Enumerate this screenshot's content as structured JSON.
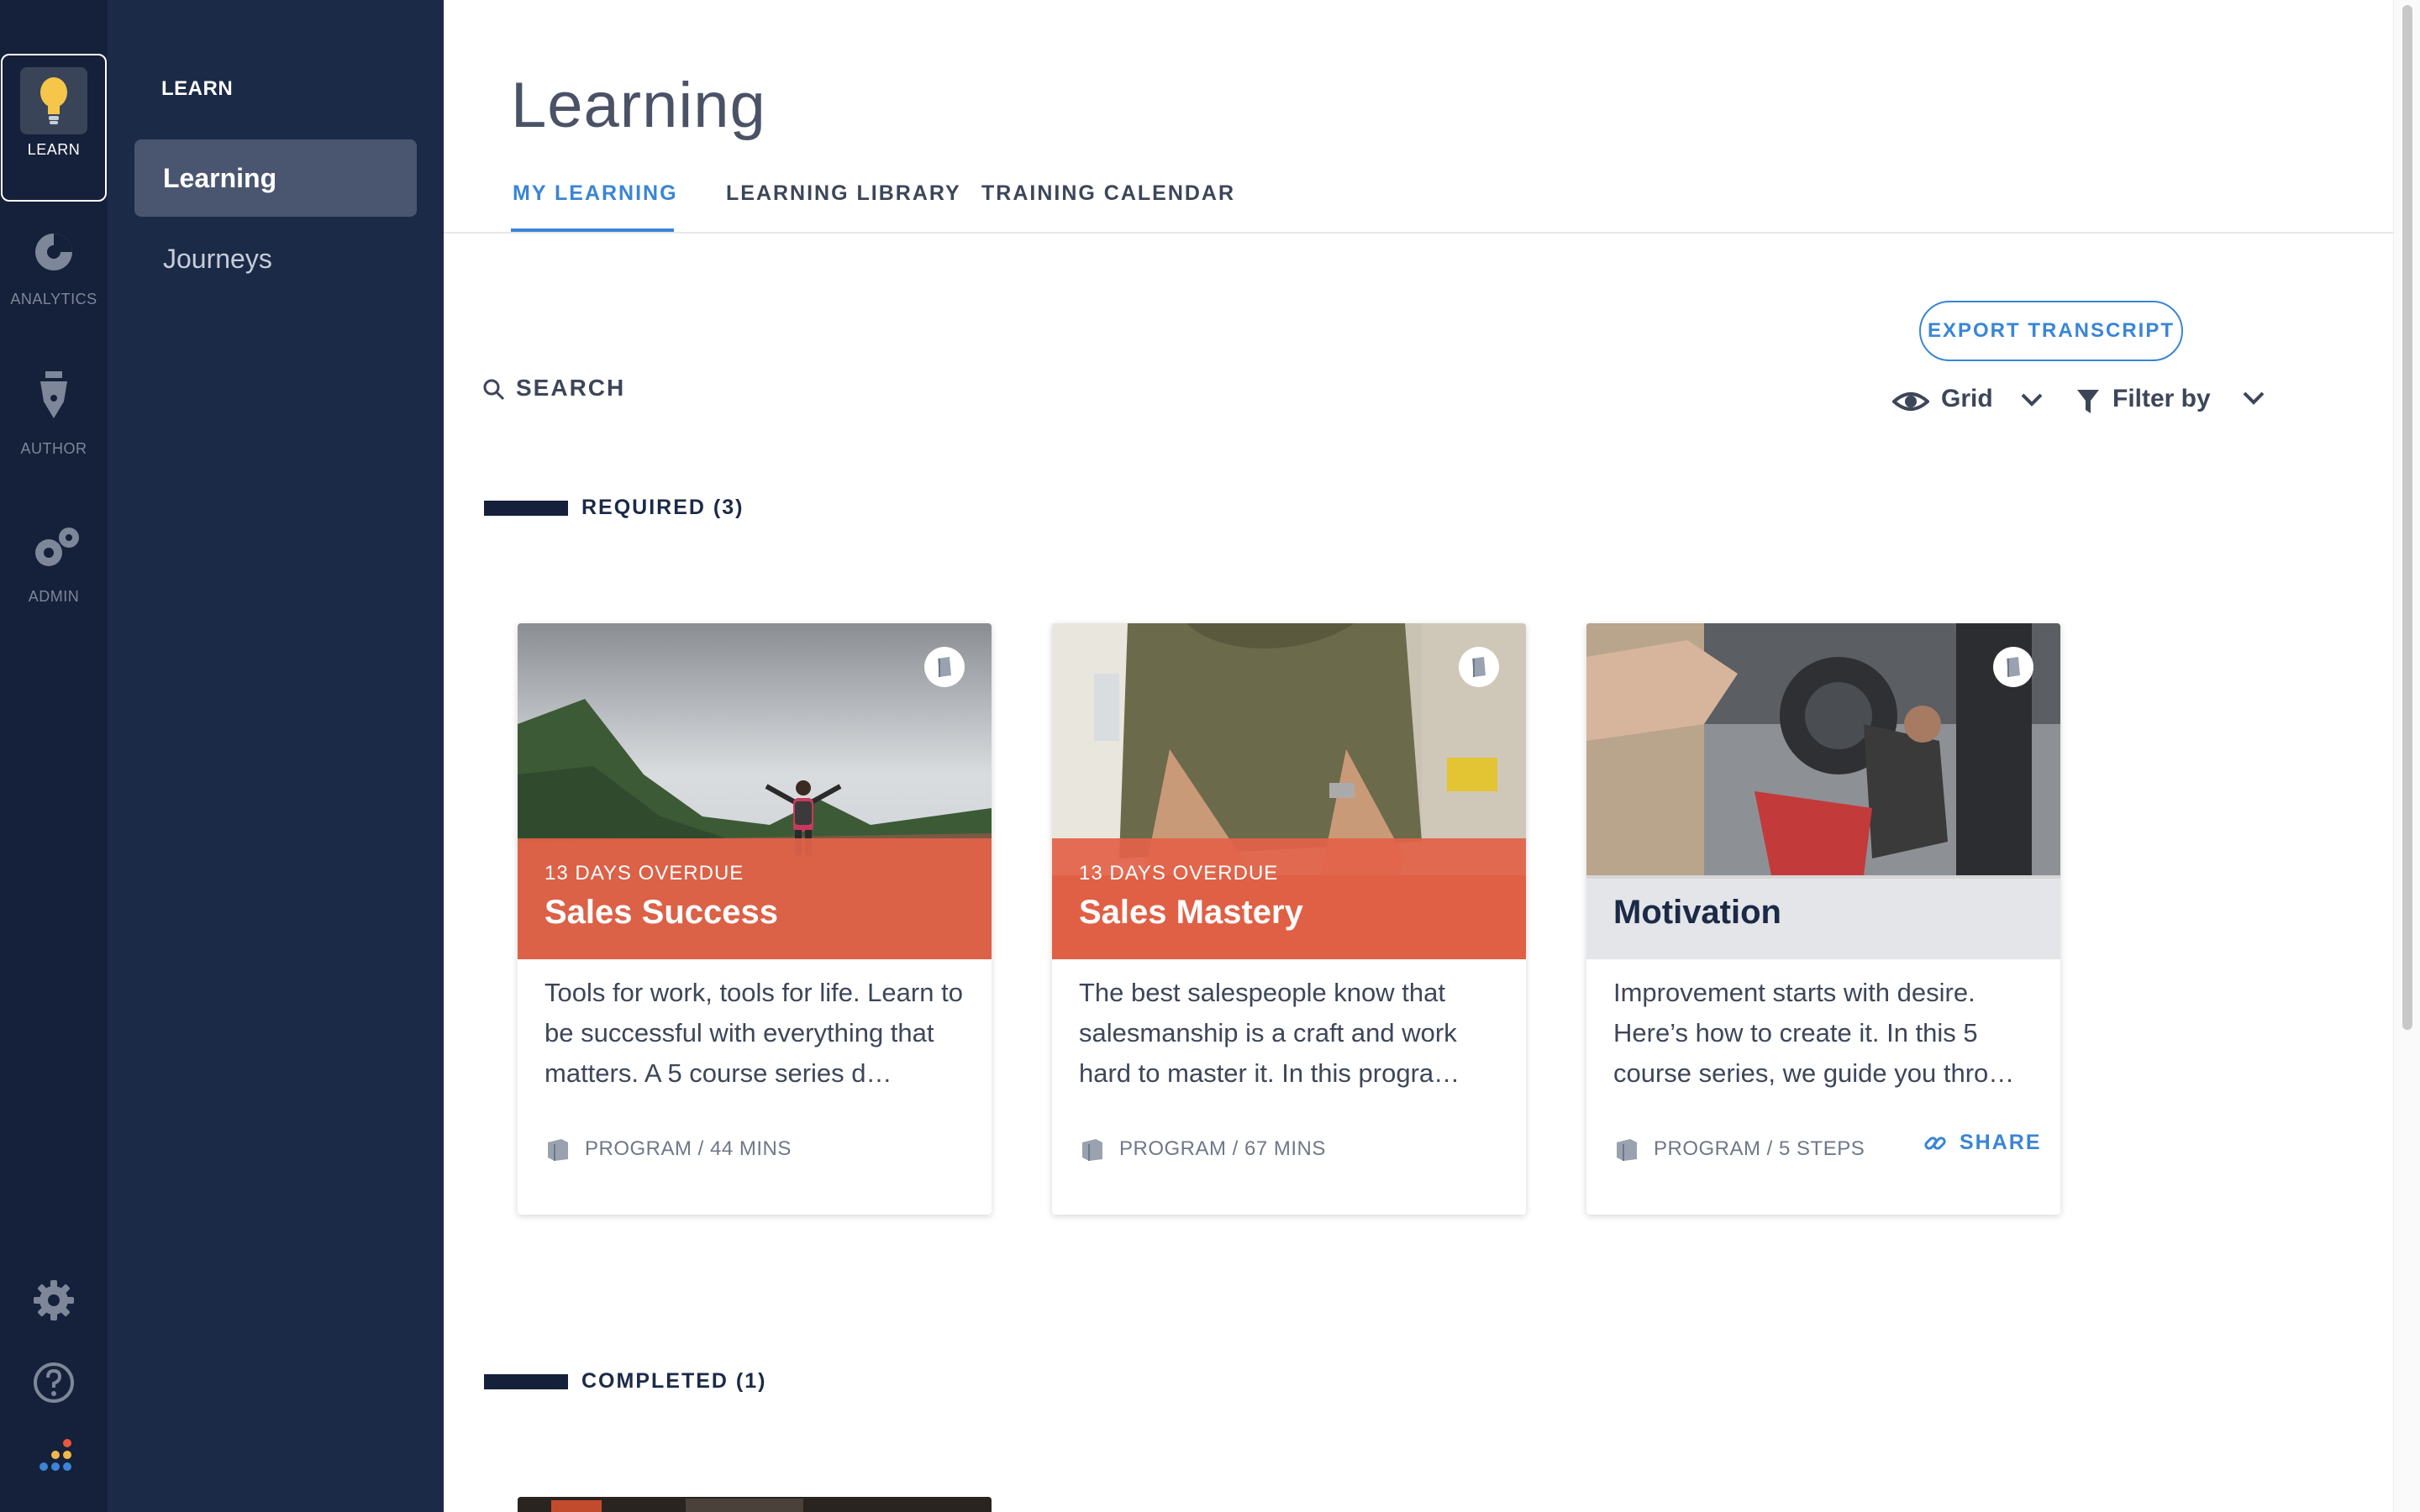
{
  "rail": {
    "items": [
      {
        "label": "LEARN",
        "icon": "lightbulb-icon",
        "active": true
      },
      {
        "label": "ANALYTICS",
        "icon": "analytics-icon"
      },
      {
        "label": "AUTHOR",
        "icon": "pen-icon"
      },
      {
        "label": "ADMIN",
        "icon": "gears-icon"
      }
    ],
    "bottom": [
      "settings-icon",
      "help-icon",
      "app-logo-icon"
    ]
  },
  "subnav": {
    "section": "LEARN",
    "items": [
      {
        "label": "Learning",
        "active": true
      },
      {
        "label": "Journeys"
      }
    ]
  },
  "page": {
    "title": "Learning",
    "tabs": [
      {
        "label": "MY LEARNING",
        "active": true
      },
      {
        "label": "LEARNING LIBRARY"
      },
      {
        "label": "TRAINING CALENDAR"
      }
    ],
    "export_label": "EXPORT TRANSCRIPT",
    "search_label": "SEARCH",
    "view_label": "Grid",
    "filter_label": "Filter by"
  },
  "sections": {
    "required": "REQUIRED (3)",
    "completed": "COMPLETED (1)"
  },
  "cards": [
    {
      "overdue": "13 DAYS OVERDUE",
      "title": "Sales Success",
      "description": "Tools for work, tools for life. Learn to be successful with everything that matters. A 5 course series d…",
      "meta": "PROGRAM / 44 MINS"
    },
    {
      "overdue": "13 DAYS OVERDUE",
      "title": "Sales Mastery",
      "description": "The best salespeople know that salesmanship is a craft and work hard to master it. In this progra…",
      "meta": "PROGRAM / 67 MINS"
    },
    {
      "overdue": "",
      "title": "Motivation",
      "description": "Improvement starts with desire. Here’s how to create it. In this 5 course series, we guide you thro…",
      "meta": "PROGRAM / 5 STEPS",
      "share_label": "SHARE"
    }
  ],
  "colors": {
    "rail_bg": "#15203a",
    "subnav_bg": "#1b2a47",
    "accent": "#3a85d6",
    "overdue": "#e36248"
  }
}
